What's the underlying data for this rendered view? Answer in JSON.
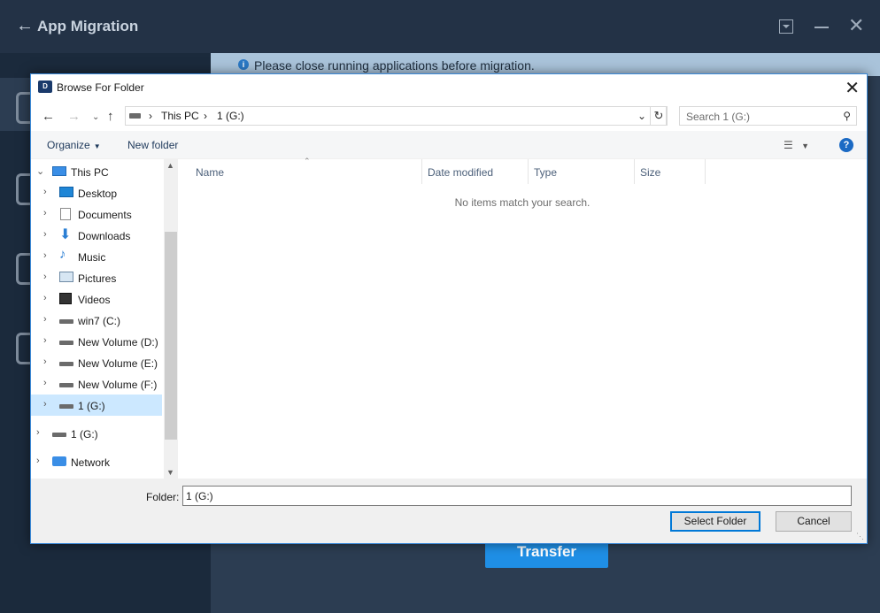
{
  "app": {
    "title": "App Migration",
    "notice": "Please close running applications before migration.",
    "transfer_label": "Transfer"
  },
  "dialog": {
    "title": "Browse For Folder",
    "address": {
      "segments": [
        "This PC",
        "1 (G:)"
      ]
    },
    "search_placeholder": "Search 1 (G:)",
    "organize_label": "Organize",
    "new_folder_label": "New folder",
    "help_label": "?",
    "tree": [
      {
        "label": "This PC",
        "icon": "pc-icon",
        "level": 0,
        "expanded": true
      },
      {
        "label": "Desktop",
        "icon": "desktop-icon",
        "level": 1
      },
      {
        "label": "Documents",
        "icon": "documents-icon",
        "level": 1
      },
      {
        "label": "Downloads",
        "icon": "downloads-icon",
        "level": 1
      },
      {
        "label": "Music",
        "icon": "music-icon",
        "level": 1
      },
      {
        "label": "Pictures",
        "icon": "pictures-icon",
        "level": 1
      },
      {
        "label": "Videos",
        "icon": "videos-icon",
        "level": 1
      },
      {
        "label": "win7 (C:)",
        "icon": "system-drive-icon",
        "level": 1
      },
      {
        "label": "New Volume (D:)",
        "icon": "drive-icon",
        "level": 1
      },
      {
        "label": "New Volume (E:)",
        "icon": "drive-icon",
        "level": 1
      },
      {
        "label": "New Volume (F:)",
        "icon": "drive-icon",
        "level": 1
      },
      {
        "label": "1 (G:)",
        "icon": "drive-icon",
        "level": 1,
        "selected": true
      },
      {
        "label": "1 (G:)",
        "icon": "drive-icon",
        "level": 0
      },
      {
        "label": "Network",
        "icon": "network-icon",
        "level": 0
      }
    ],
    "columns": [
      "Name",
      "Date modified",
      "Type",
      "Size"
    ],
    "empty_message": "No items match your search.",
    "folder_label": "Folder:",
    "folder_value": "1 (G:)",
    "select_label": "Select Folder",
    "cancel_label": "Cancel"
  },
  "colors": {
    "app_bg": "#233246",
    "accent": "#1f8fe6",
    "selection": "#cce8ff",
    "dialog_border": "#3c8ad8"
  }
}
